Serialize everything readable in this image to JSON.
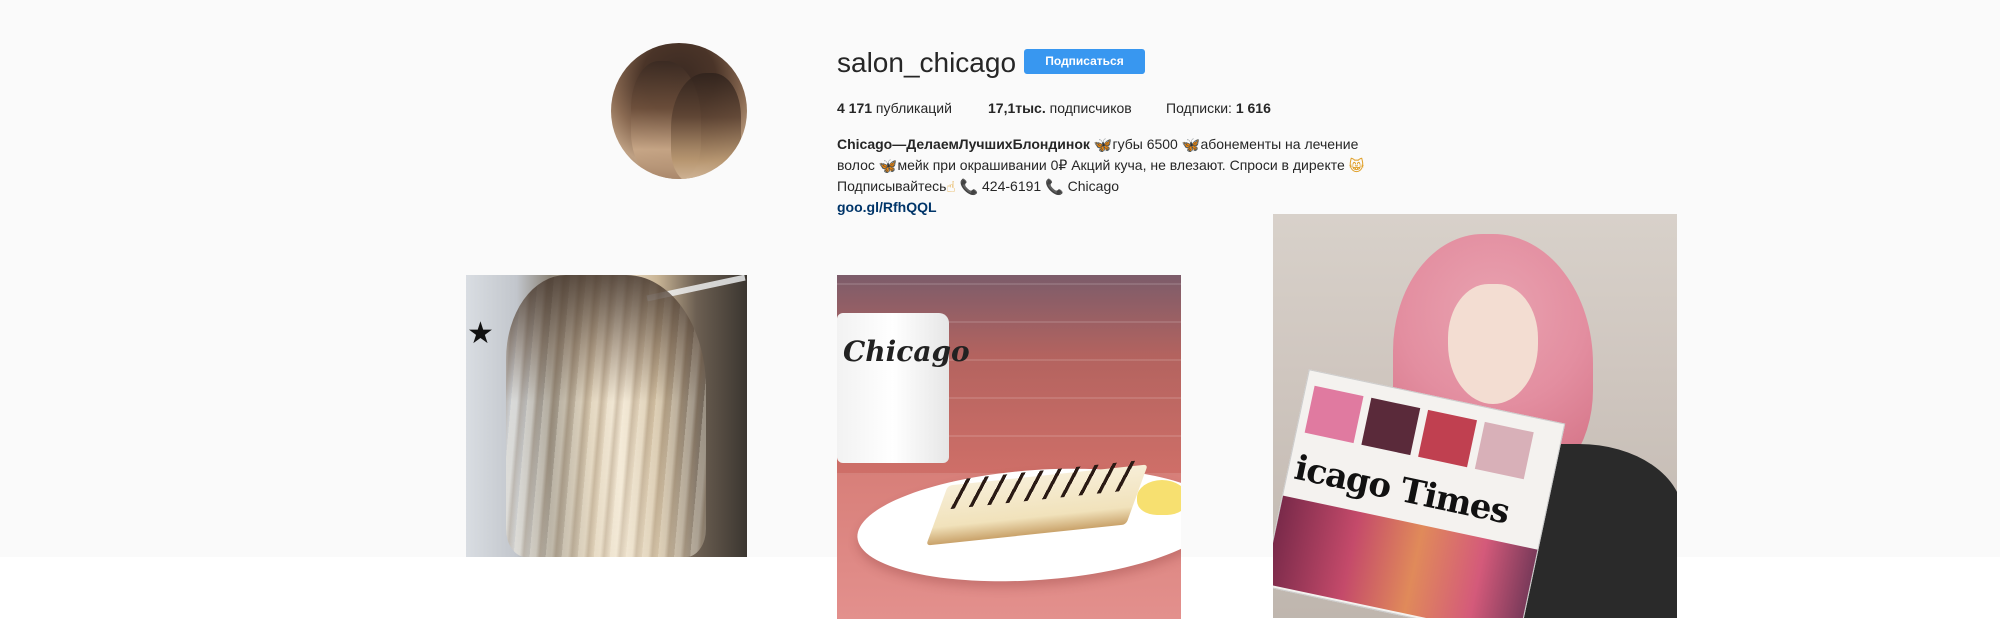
{
  "profile": {
    "username": "salon_chicago",
    "follow_label": "Подписаться",
    "stats": {
      "posts_count": "4 171",
      "posts_label": " публикаций",
      "followers_count": "17,1тыс.",
      "followers_label": " подписчиков",
      "following_label": "Подписки: ",
      "following_count": "1 616"
    },
    "bio": {
      "name": "Chicago—ДелаемЛучшихБлондинок",
      "line1_rest_a": "губы 6500 ",
      "line1_rest_b": "абонементы на лечение",
      "line2_a": "волос ",
      "line2_b": "мейк при окрашивании 0₽ Акций куча, не влезают. Спроси в директе ",
      "line3_a": "Подписывайтесь",
      "line3_b": " 424-6191 ",
      "line3_c": " Chicago",
      "link": "goo.gl/RfhQQL"
    }
  },
  "posts": {
    "post2_mug_text": "Chicago",
    "post3_paper_title": "icago Times"
  },
  "icons": {
    "butterfly": "🦋",
    "phone": "📞",
    "hand": "☝",
    "cat": "😸",
    "star": "★"
  },
  "colors": {
    "button": "#3897f0",
    "link": "#003569",
    "background": "#fafafa"
  }
}
